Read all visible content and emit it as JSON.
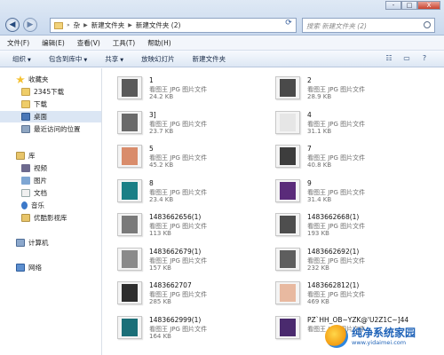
{
  "window": {
    "breadcrumb": [
      "杂",
      "新建文件夹",
      "新建文件夹 (2)"
    ],
    "search_placeholder": "搜索 新建文件夹 (2)",
    "controls": [
      "-",
      "□",
      "X"
    ]
  },
  "menu": [
    "文件(F)",
    "编辑(E)",
    "查看(V)",
    "工具(T)",
    "帮助(H)"
  ],
  "toolbar": {
    "organize": "组织",
    "include_in_library": "包含到库中",
    "share": "共享",
    "slideshow": "放映幻灯片",
    "new_folder": "新建文件夹"
  },
  "nav": {
    "favorites": "收藏夹",
    "fav_items": [
      "2345下载",
      "下载",
      "桌面",
      "最近访问的位置"
    ],
    "libraries": "库",
    "lib_items": [
      "视频",
      "图片",
      "文档",
      "音乐",
      "优酷影视库"
    ],
    "computer": "计算机",
    "network": "网络"
  },
  "files": [
    {
      "name": "1",
      "type": "看图王 JPG 图片文件",
      "size": "24.2 KB",
      "thumb": "#5a5a5a"
    },
    {
      "name": "2",
      "type": "看图王 JPG 图片文件",
      "size": "28.9 KB",
      "thumb": "#4a4a4a"
    },
    {
      "name": "3]",
      "type": "看图王 JPG 图片文件",
      "size": "23.7 KB",
      "thumb": "#6a6a6a"
    },
    {
      "name": "4",
      "type": "看图王 JPG 图片文件",
      "size": "31.1 KB",
      "thumb": "#e6e6e6"
    },
    {
      "name": "5",
      "type": "看图王 JPG 图片文件",
      "size": "45.2 KB",
      "thumb": "#d98c6b"
    },
    {
      "name": "7",
      "type": "看图王 JPG 图片文件",
      "size": "40.8 KB",
      "thumb": "#3d3d3d"
    },
    {
      "name": "8",
      "type": "看图王 JPG 图片文件",
      "size": "23.4 KB",
      "thumb": "#1b7f86"
    },
    {
      "name": "9",
      "type": "看图王 JPG 图片文件",
      "size": "31.4 KB",
      "thumb": "#5a2b7a"
    },
    {
      "name": "1483662656(1)",
      "type": "看图王 JPG 图片文件",
      "size": "113 KB",
      "thumb": "#7a7a7a"
    },
    {
      "name": "1483662668(1)",
      "type": "看图王 JPG 图片文件",
      "size": "193 KB",
      "thumb": "#4e4e4e"
    },
    {
      "name": "1483662679(1)",
      "type": "看图王 JPG 图片文件",
      "size": "157 KB",
      "thumb": "#8a8a8a"
    },
    {
      "name": "1483662692(1)",
      "type": "看图王 JPG 图片文件",
      "size": "232 KB",
      "thumb": "#5e5e5e"
    },
    {
      "name": "1483662707",
      "type": "看图王 JPG 图片文件",
      "size": "285 KB",
      "thumb": "#2e2e2e"
    },
    {
      "name": "1483662812(1)",
      "type": "看图王 JPG 图片文件",
      "size": "469 KB",
      "thumb": "#e8b9a0"
    },
    {
      "name": "1483662999(1)",
      "type": "看图王 JPG 图片文件",
      "size": "164 KB",
      "thumb": "#1b6f78"
    },
    {
      "name": "PZ`HH_OB~YZK@'U2Z1C~]44",
      "type": "看图王 JPG 图片文件",
      "size": "",
      "thumb": "#4a2a6e"
    }
  ],
  "watermark": {
    "title": "纯净系统家园",
    "url": "www.yidaimei.com"
  }
}
